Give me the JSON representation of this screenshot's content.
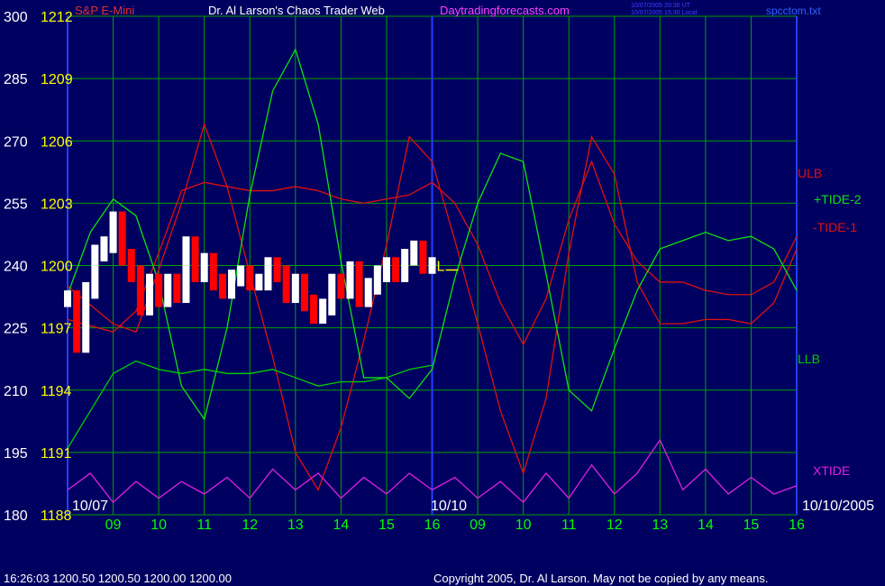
{
  "header": {
    "instrument": "S&P E-Mini",
    "title": "Dr. Al Larson's Chaos Trader Web",
    "site": "Daytradingforecasts.com",
    "stamp_ut": "10/07/2005 20:30 UT",
    "stamp_local": "10/07/2005 15:30 Local",
    "filename": "spcctom.txt"
  },
  "footer": {
    "quote": "16:26:03  1200.50 1200.50 1200.00 1200.00",
    "copyright": "Copyright 2005, Dr. Al Larson. May not be copied by any means."
  },
  "colors": {
    "background": "#000060",
    "grid": "#00a000",
    "price_axis": "#ffff00",
    "left_axis": "#ffffff",
    "time_axis": "#00ff00",
    "ulb": "#e01010",
    "tide2": "#10e010",
    "llb": "#00d000",
    "xtide": "#e020e0",
    "price_up": "#ffffff",
    "price_down": "#ff0000",
    "current_marker": "#ffff00",
    "avg": "#ffff80"
  },
  "chart_data": {
    "type": "line",
    "left_axis": {
      "ticks": [
        "300",
        "285",
        "270",
        "255",
        "240",
        "225",
        "210",
        "195",
        "180"
      ],
      "range": [
        180,
        300
      ]
    },
    "price_axis": {
      "ticks": [
        "1212",
        "1209",
        "1206",
        "1203",
        "1200",
        "1197",
        "1194",
        "1191",
        "1188"
      ],
      "range": [
        1188,
        1212
      ]
    },
    "x_ticks": [
      "09",
      "10",
      "11",
      "12",
      "13",
      "14",
      "15",
      "16",
      "09",
      "10",
      "11",
      "12",
      "13",
      "14",
      "15",
      "16"
    ],
    "date_labels": [
      "10/07",
      "10/10",
      "10/10/2005"
    ],
    "legend": [
      "ULB",
      "+TIDE-2",
      "-TIDE-1",
      "LLB",
      "XTIDE"
    ],
    "current_marker": "L",
    "current_price": 1200,
    "series": [
      {
        "name": "ULB",
        "color": "#e01010",
        "x": [
          0,
          1,
          1.5,
          2,
          2.5,
          3,
          3.5,
          4,
          4.5,
          5,
          5.5,
          6,
          6.5,
          7,
          7.5,
          8,
          8.5,
          9,
          9.5,
          10,
          10.5,
          11,
          11.5,
          12,
          12.5,
          13,
          13.5,
          14,
          14.5,
          15,
          15.5,
          16
        ],
        "y": [
          227,
          224,
          229,
          243,
          258,
          260,
          259,
          258,
          258,
          259,
          258,
          256,
          255,
          256,
          257,
          260,
          255,
          245,
          231,
          221,
          232,
          251,
          265,
          250,
          241,
          236,
          236,
          234,
          233,
          233,
          236,
          247
        ]
      },
      {
        "name": "-TIDE-1",
        "color": "#e01010",
        "x": [
          0,
          1,
          1.5,
          2,
          2.5,
          3,
          3.5,
          4,
          4.5,
          5,
          5.5,
          6,
          6.5,
          7,
          7.5,
          8,
          8.5,
          9,
          9.5,
          10,
          10.5,
          11,
          11.5,
          12,
          12.5,
          13,
          13.5,
          14,
          14.5,
          15,
          15.5,
          16
        ],
        "y": [
          235,
          226,
          224,
          239,
          255,
          274,
          259,
          238,
          218,
          195,
          186,
          201,
          222,
          245,
          271,
          265,
          246,
          226,
          205,
          190,
          208,
          243,
          271,
          262,
          236,
          226,
          226,
          227,
          227,
          226,
          231,
          244
        ]
      },
      {
        "name": "+TIDE-2",
        "color": "#10e010",
        "x": [
          0,
          0.5,
          1,
          1.5,
          2,
          2.5,
          3,
          3.5,
          4,
          4.5,
          5,
          5.5,
          6,
          6.5,
          7,
          7.5,
          8,
          8.5,
          9,
          9.5,
          10,
          10.5,
          11,
          11.5,
          12,
          12.5,
          13,
          13.5,
          14,
          14.5,
          15,
          15.5,
          16
        ],
        "y": [
          233,
          248,
          256,
          252,
          236,
          211,
          203,
          225,
          257,
          282,
          292,
          274,
          241,
          213,
          213,
          208,
          215,
          237,
          255,
          267,
          265,
          238,
          210,
          205,
          220,
          234,
          244,
          246,
          248,
          246,
          247,
          244,
          234
        ]
      },
      {
        "name": "LLB",
        "color": "#00d000",
        "x": [
          0,
          0.5,
          1,
          1.5,
          2,
          2.5,
          3,
          3.5,
          4,
          4.5,
          5,
          5.5,
          6,
          6.5,
          7,
          7.5,
          8
        ],
        "y": [
          196,
          205,
          214,
          217,
          215,
          214,
          215,
          214,
          214,
          215,
          213,
          211,
          212,
          212,
          213,
          215,
          216
        ]
      },
      {
        "name": "XTIDE",
        "color": "#e020e0",
        "x": [
          0,
          0.5,
          1,
          1.5,
          2,
          2.5,
          3,
          3.5,
          4,
          4.5,
          5,
          5.5,
          6,
          6.5,
          7,
          7.5,
          8,
          8.5,
          9,
          9.5,
          10,
          10.5,
          11,
          11.5,
          12,
          12.5,
          13,
          13.5,
          14,
          14.5,
          15,
          15.5,
          16
        ],
        "y": [
          186,
          190,
          183,
          188,
          184,
          188,
          185,
          189,
          184,
          191,
          186,
          190,
          184,
          189,
          185,
          190,
          186,
          189,
          184,
          188,
          183,
          190,
          184,
          192,
          185,
          190,
          198,
          186,
          191,
          185,
          189,
          185,
          187
        ]
      },
      {
        "name": "Price",
        "color": "#ffffff",
        "x": [
          0,
          0.2,
          0.4,
          0.6,
          0.8,
          1,
          1.2,
          1.4,
          1.6,
          1.8,
          2,
          2.2,
          2.4,
          2.6,
          2.8,
          3,
          3.2,
          3.4,
          3.6,
          3.8,
          4,
          4.2,
          4.4,
          4.6,
          4.8,
          5,
          5.2,
          5.4,
          5.6,
          5.8,
          6,
          6.2,
          6.4,
          6.6,
          6.8,
          7,
          7.2,
          7.4,
          7.6,
          7.8,
          8
        ],
        "y": [
          232,
          221,
          234,
          243,
          245,
          251,
          242,
          238,
          230,
          236,
          232,
          236,
          233,
          245,
          238,
          241,
          236,
          234,
          237,
          238,
          236,
          236,
          240,
          238,
          233,
          236,
          231,
          228,
          230,
          236,
          234,
          239,
          232,
          235,
          238,
          240,
          238,
          242,
          244,
          240,
          240
        ]
      }
    ]
  }
}
